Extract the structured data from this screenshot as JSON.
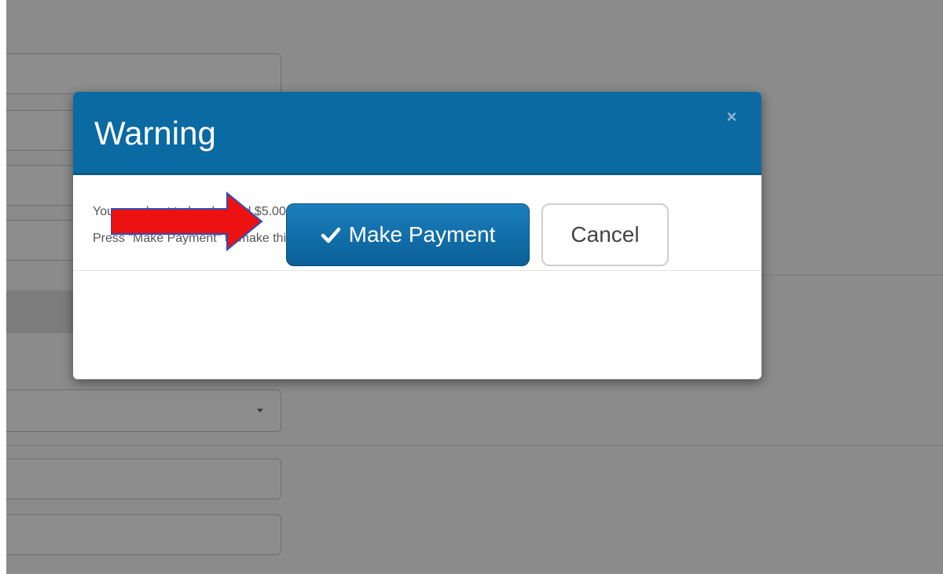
{
  "dialog": {
    "title": "Warning",
    "close_symbol": "×",
    "message_line_1": "You are about to be charged $5.00.",
    "message_line_2": "Press \"Make Payment\" to make this payment.",
    "confirm_label": "Make Payment",
    "cancel_label": "Cancel"
  },
  "icons": {
    "confirm_icon": "check-icon",
    "close_icon": "close-icon",
    "annotation": "red-arrow-icon",
    "select_arrow": "caret-down-icon"
  },
  "colors": {
    "header": "#0b6aa2",
    "primary_button": "#0b6aa2",
    "overlay": "#8b8b8b",
    "annotation_arrow": "#ee1111"
  }
}
